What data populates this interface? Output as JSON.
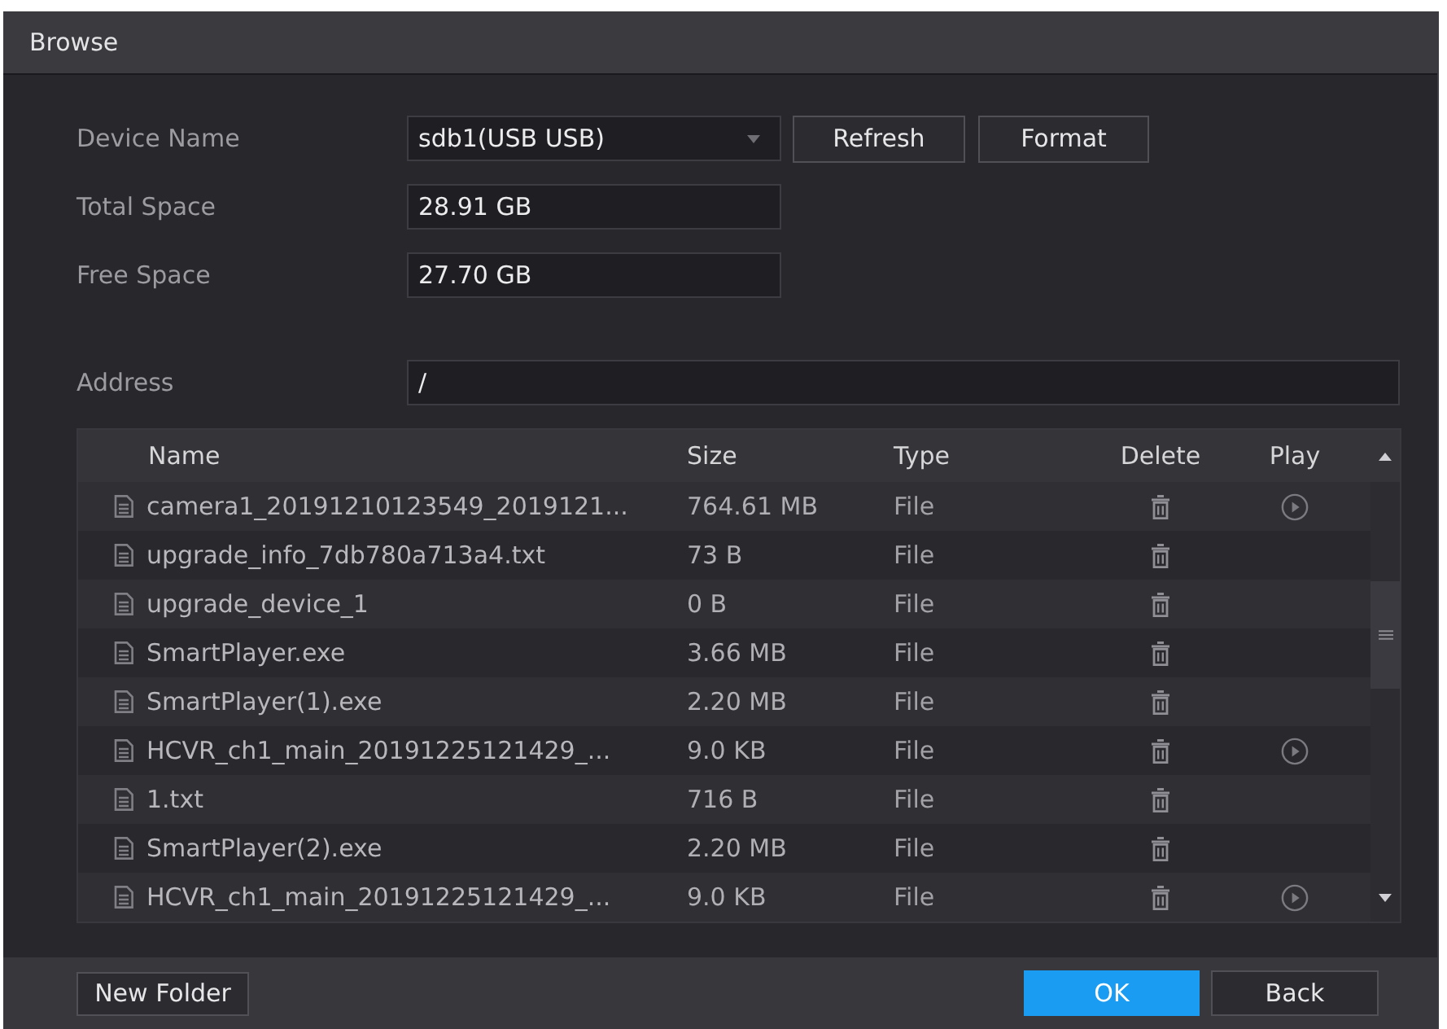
{
  "window": {
    "title": "Browse"
  },
  "fields": [
    {
      "label": "Device Name",
      "kind": "dropdown",
      "value": "sdb1(USB USB)",
      "buttons": [
        "Refresh",
        "Format"
      ]
    },
    {
      "label": "Total Space",
      "kind": "text",
      "value": "28.91 GB"
    },
    {
      "label": "Free Space",
      "kind": "text",
      "value": "27.70 GB"
    }
  ],
  "address": {
    "label": "Address",
    "value": "/"
  },
  "table": {
    "columns": [
      "Name",
      "Size",
      "Type",
      "Delete",
      "Play"
    ],
    "rows": [
      {
        "name": "camera1_20191210123549_2019121...",
        "size": "764.61 MB",
        "type": "File",
        "playable": true
      },
      {
        "name": "upgrade_info_7db780a713a4.txt",
        "size": "73 B",
        "type": "File",
        "playable": false
      },
      {
        "name": "upgrade_device_1",
        "size": "0 B",
        "type": "File",
        "playable": false
      },
      {
        "name": "SmartPlayer.exe",
        "size": "3.66 MB",
        "type": "File",
        "playable": false
      },
      {
        "name": "SmartPlayer(1).exe",
        "size": "2.20 MB",
        "type": "File",
        "playable": false
      },
      {
        "name": "HCVR_ch1_main_20191225121429_...",
        "size": "9.0 KB",
        "type": "File",
        "playable": true
      },
      {
        "name": "1.txt",
        "size": "716 B",
        "type": "File",
        "playable": false
      },
      {
        "name": "SmartPlayer(2).exe",
        "size": "2.20 MB",
        "type": "File",
        "playable": false
      },
      {
        "name": "HCVR_ch1_main_20191225121429_...",
        "size": "9.0 KB",
        "type": "File",
        "playable": true
      }
    ]
  },
  "footer_left": [
    {
      "label": "New Folder",
      "kind": "plain"
    }
  ],
  "footer_right": [
    {
      "label": "OK",
      "kind": "primary"
    },
    {
      "label": "Back",
      "kind": "plain"
    }
  ]
}
